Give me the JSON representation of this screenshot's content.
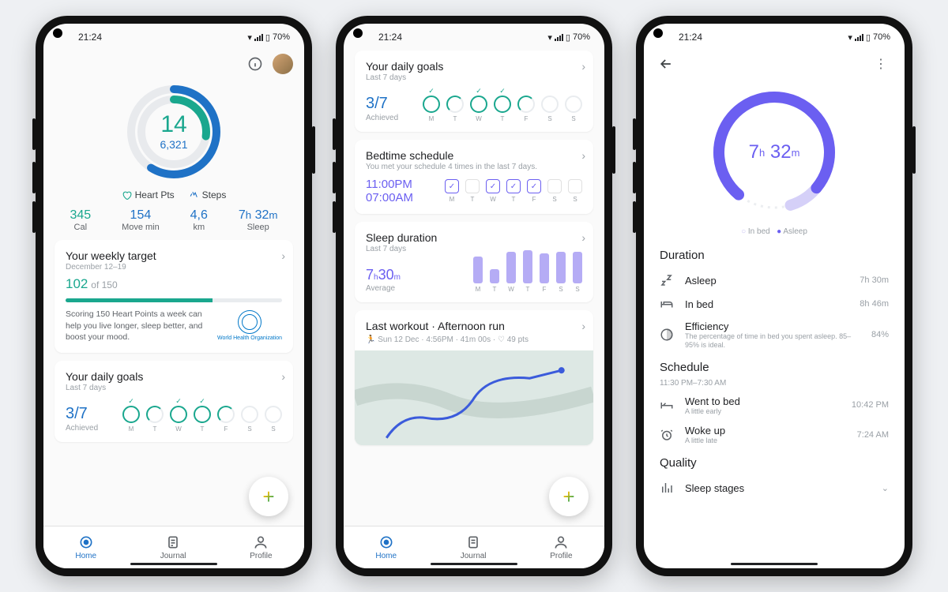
{
  "statusbar": {
    "time": "21:24",
    "battery": "70%"
  },
  "phone1": {
    "ring": {
      "heart_pts": "14",
      "steps": "6,321",
      "heart_label": "Heart Pts",
      "steps_label": "Steps"
    },
    "stats": [
      {
        "value": "345",
        "label": "Cal",
        "color": "green"
      },
      {
        "value": "154",
        "label": "Move min"
      },
      {
        "value": "4,6",
        "label": "km"
      },
      {
        "value_html": "7h 32m",
        "label": "Sleep"
      }
    ],
    "weekly": {
      "title": "Your weekly target",
      "period": "December 12–19",
      "score": "102",
      "target": "of 150",
      "msg": "Scoring 150 Heart Points a week can help you live longer, sleep better, and boost your mood.",
      "who": "World Health Organization"
    },
    "goals": {
      "title": "Your daily goals",
      "subtitle": "Last 7 days",
      "ratio": "3/7",
      "status": "Achieved",
      "days": [
        "M",
        "T",
        "W",
        "T",
        "F",
        "S",
        "S"
      ],
      "checks": [
        true,
        false,
        true,
        true,
        false,
        false,
        false
      ],
      "rings": [
        "on",
        "half",
        "on",
        "on",
        "half",
        "",
        ""
      ]
    }
  },
  "phone2": {
    "bedtime": {
      "title": "Bedtime schedule",
      "subtitle": "You met your schedule 4 times in the last 7 days.",
      "bed": "11:00PM",
      "wake": "07:00AM",
      "days": [
        "M",
        "T",
        "W",
        "T",
        "F",
        "S",
        "S"
      ],
      "checks": [
        true,
        false,
        true,
        true,
        true,
        false,
        false
      ]
    },
    "sleep": {
      "title": "Sleep duration",
      "subtitle": "Last 7 days",
      "avg": "7h30m",
      "avglabel": "Average",
      "days": [
        "M",
        "T",
        "W",
        "T",
        "F",
        "S",
        "S"
      ],
      "bars": [
        34,
        18,
        40,
        42,
        38,
        40,
        40
      ]
    },
    "workout": {
      "title": "Last workout · Afternoon run",
      "meta": "Sun 12 Dec · 4:56PM · 41m 00s · ♡ 49 pts"
    }
  },
  "phone3": {
    "total": "7h 32m",
    "legend": {
      "inbed": "In bed",
      "asleep": "Asleep"
    },
    "duration": {
      "header": "Duration",
      "items": [
        {
          "icon": "sleep",
          "title": "Asleep",
          "value": "7h 30m"
        },
        {
          "icon": "bed",
          "title": "In bed",
          "value": "8h 46m"
        },
        {
          "icon": "efficiency",
          "title": "Efficiency",
          "desc": "The percentage of time in bed you spent asleep. 85–95% is ideal.",
          "value": "84%"
        }
      ]
    },
    "schedule": {
      "header": "Schedule",
      "times": "11:30 PM–7:30 AM",
      "items": [
        {
          "icon": "bedtime",
          "title": "Went to bed",
          "desc": "A little early",
          "value": "10:42 PM"
        },
        {
          "icon": "alarm",
          "title": "Woke up",
          "desc": "A little late",
          "value": "7:24 AM"
        }
      ]
    },
    "quality": {
      "header": "Quality",
      "stages": "Sleep stages"
    }
  },
  "nav": {
    "home": "Home",
    "journal": "Journal",
    "profile": "Profile"
  }
}
